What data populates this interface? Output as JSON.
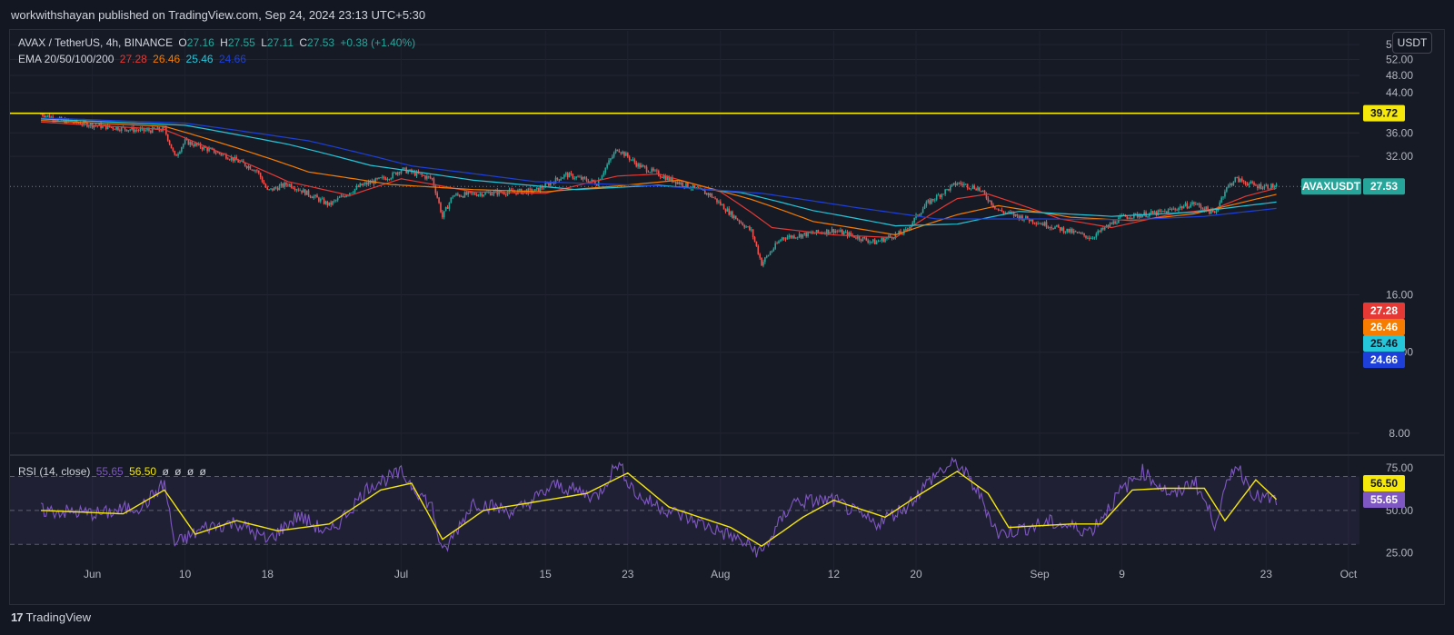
{
  "header": {
    "published_text": "workwithshayan published on TradingView.com, Sep 24, 2024 23:13 UTC+5:30"
  },
  "legend": {
    "symbol": "AVAX / TetherUS, 4h, BINANCE",
    "o_label": "O",
    "o_value": "27.16",
    "h_label": "H",
    "h_value": "27.55",
    "l_label": "L",
    "l_value": "27.11",
    "c_label": "C",
    "c_value": "27.53",
    "change": "+0.38 (+1.40%)",
    "ema_label": "EMA 20/50/100/200",
    "ema20": "27.28",
    "ema50": "26.46",
    "ema100": "25.46",
    "ema200": "24.66"
  },
  "rsi_legend": {
    "label": "RSI (14, close)",
    "rsi": "55.65",
    "ma": "56.50",
    "extras": [
      "ø",
      "ø",
      "ø",
      "ø"
    ]
  },
  "unit_button": "USDT",
  "footer": {
    "brand": "TradingView",
    "logo_glyph": "17"
  },
  "colors": {
    "bg": "#161a25",
    "up": "#26a69a",
    "down": "#ef5350",
    "ema20": "#e53935",
    "ema50": "#f57c00",
    "ema100": "#26c6da",
    "ema200": "#1e40d8",
    "resistance": "#f5e80a",
    "rsi": "#7e57c2",
    "rsi_ma": "#f5e80a"
  },
  "chart_data": [
    {
      "type": "candlestick",
      "title": "AVAX / TetherUS, 4h, BINANCE",
      "y_scale": "log",
      "ylim": [
        7.2,
        60
      ],
      "y_ticks": [
        "56.00",
        "52.00",
        "48.00",
        "44.00",
        "36.00",
        "32.00",
        "16.00",
        "12.00",
        "8.00"
      ],
      "x_ticks": [
        "Jun",
        "10",
        "18",
        "Jul",
        "15",
        "23",
        "Aug",
        "12",
        "20",
        "Sep",
        "9",
        "23",
        "Oct"
      ],
      "resistance_level": {
        "value": 39.72,
        "label": "39.72"
      },
      "last_price": {
        "label": "AVAXUSDT",
        "value": "27.53"
      },
      "price_series": {
        "name": "AVAXUSDT",
        "anchors": [
          [
            "2024-05-27",
            39.6
          ],
          [
            "2024-05-29",
            38.3
          ],
          [
            "2024-06-02",
            37.2
          ],
          [
            "2024-06-06",
            36.4
          ],
          [
            "2024-06-08",
            36.6
          ],
          [
            "2024-06-09",
            31.9
          ],
          [
            "2024-06-10",
            34.5
          ],
          [
            "2024-06-14",
            32.1
          ],
          [
            "2024-06-17",
            29.8
          ],
          [
            "2024-06-18",
            26.9
          ],
          [
            "2024-06-20",
            27.9
          ],
          [
            "2024-06-24",
            25.1
          ],
          [
            "2024-06-27",
            27.6
          ],
          [
            "2024-06-30",
            29.0
          ],
          [
            "2024-07-01",
            30.0
          ],
          [
            "2024-07-04",
            28.6
          ],
          [
            "2024-07-05",
            23.6
          ],
          [
            "2024-07-06",
            26.3
          ],
          [
            "2024-07-10",
            26.7
          ],
          [
            "2024-07-14",
            26.9
          ],
          [
            "2024-07-17",
            29.2
          ],
          [
            "2024-07-20",
            28.0
          ],
          [
            "2024-07-22",
            33.3
          ],
          [
            "2024-07-24",
            30.6
          ],
          [
            "2024-07-27",
            28.6
          ],
          [
            "2024-07-31",
            26.4
          ],
          [
            "2024-08-02",
            24.0
          ],
          [
            "2024-08-04",
            22.0
          ],
          [
            "2024-08-05",
            18.7
          ],
          [
            "2024-08-07",
            21.3
          ],
          [
            "2024-08-12",
            22.1
          ],
          [
            "2024-08-16",
            20.8
          ],
          [
            "2024-08-19",
            22.0
          ],
          [
            "2024-08-21",
            25.2
          ],
          [
            "2024-08-24",
            28.0
          ],
          [
            "2024-08-26",
            27.3
          ],
          [
            "2024-08-28",
            24.4
          ],
          [
            "2024-09-02",
            22.6
          ],
          [
            "2024-09-06",
            21.3
          ],
          [
            "2024-09-09",
            23.6
          ],
          [
            "2024-09-13",
            24.2
          ],
          [
            "2024-09-16",
            25.3
          ],
          [
            "2024-09-18",
            24.0
          ],
          [
            "2024-09-19",
            27.0
          ],
          [
            "2024-09-20",
            28.6
          ],
          [
            "2024-09-22",
            27.6
          ],
          [
            "2024-09-24",
            27.53
          ]
        ]
      },
      "series": [
        {
          "name": "EMA 20",
          "anchors": [
            [
              "2024-05-27",
              38.0
            ],
            [
              "2024-06-08",
              36.6
            ],
            [
              "2024-06-12",
              33.6
            ],
            [
              "2024-06-20",
              28.2
            ],
            [
              "2024-06-26",
              26.3
            ],
            [
              "2024-07-01",
              28.6
            ],
            [
              "2024-07-08",
              26.8
            ],
            [
              "2024-07-15",
              26.6
            ],
            [
              "2024-07-22",
              29.0
            ],
            [
              "2024-07-26",
              29.3
            ],
            [
              "2024-08-01",
              26.8
            ],
            [
              "2024-08-06",
              22.4
            ],
            [
              "2024-08-12",
              21.6
            ],
            [
              "2024-08-18",
              21.3
            ],
            [
              "2024-08-24",
              25.9
            ],
            [
              "2024-08-27",
              26.5
            ],
            [
              "2024-09-03",
              23.4
            ],
            [
              "2024-09-08",
              22.4
            ],
            [
              "2024-09-14",
              24.0
            ],
            [
              "2024-09-18",
              24.6
            ],
            [
              "2024-09-21",
              26.2
            ],
            [
              "2024-09-24",
              27.28
            ]
          ]
        },
        {
          "name": "EMA 50",
          "anchors": [
            [
              "2024-05-27",
              38.3
            ],
            [
              "2024-06-08",
              37.2
            ],
            [
              "2024-06-15",
              33.4
            ],
            [
              "2024-06-22",
              29.6
            ],
            [
              "2024-06-30",
              27.8
            ],
            [
              "2024-07-08",
              27.1
            ],
            [
              "2024-07-15",
              26.8
            ],
            [
              "2024-07-22",
              27.6
            ],
            [
              "2024-07-28",
              28.4
            ],
            [
              "2024-08-04",
              25.8
            ],
            [
              "2024-08-10",
              23.1
            ],
            [
              "2024-08-18",
              21.6
            ],
            [
              "2024-08-24",
              23.9
            ],
            [
              "2024-08-28",
              25.0
            ],
            [
              "2024-09-04",
              23.6
            ],
            [
              "2024-09-10",
              23.2
            ],
            [
              "2024-09-16",
              24.0
            ],
            [
              "2024-09-20",
              25.2
            ],
            [
              "2024-09-24",
              26.46
            ]
          ]
        },
        {
          "name": "EMA 100",
          "anchors": [
            [
              "2024-05-27",
              38.6
            ],
            [
              "2024-06-10",
              37.4
            ],
            [
              "2024-06-20",
              34.0
            ],
            [
              "2024-06-28",
              30.6
            ],
            [
              "2024-07-08",
              28.4
            ],
            [
              "2024-07-18",
              27.1
            ],
            [
              "2024-07-26",
              27.7
            ],
            [
              "2024-08-03",
              26.7
            ],
            [
              "2024-08-10",
              24.4
            ],
            [
              "2024-08-18",
              22.6
            ],
            [
              "2024-08-24",
              22.8
            ],
            [
              "2024-08-30",
              24.3
            ],
            [
              "2024-09-08",
              23.7
            ],
            [
              "2024-09-16",
              24.2
            ],
            [
              "2024-09-24",
              25.46
            ]
          ]
        },
        {
          "name": "EMA 200",
          "anchors": [
            [
              "2024-05-27",
              38.8
            ],
            [
              "2024-06-10",
              37.8
            ],
            [
              "2024-06-22",
              34.6
            ],
            [
              "2024-07-02",
              30.5
            ],
            [
              "2024-07-14",
              28.2
            ],
            [
              "2024-07-26",
              27.6
            ],
            [
              "2024-08-05",
              26.6
            ],
            [
              "2024-08-14",
              24.8
            ],
            [
              "2024-08-22",
              23.4
            ],
            [
              "2024-09-01",
              23.4
            ],
            [
              "2024-09-10",
              23.3
            ],
            [
              "2024-09-17",
              23.7
            ],
            [
              "2024-09-24",
              24.66
            ]
          ]
        }
      ]
    },
    {
      "type": "line",
      "title": "RSI (14, close)",
      "ylim": [
        20,
        82
      ],
      "y_ticks": [
        "75.00",
        "50.00",
        "25.00"
      ],
      "bands": [
        70,
        30
      ],
      "series": [
        {
          "name": "RSI",
          "last": 55.65,
          "anchors": [
            [
              "2024-05-27",
              50
            ],
            [
              "2024-06-02",
              48
            ],
            [
              "2024-06-06",
              53
            ],
            [
              "2024-06-08",
              66
            ],
            [
              "2024-06-09",
              30
            ],
            [
              "2024-06-12",
              40
            ],
            [
              "2024-06-15",
              43
            ],
            [
              "2024-06-18",
              32
            ],
            [
              "2024-06-21",
              47
            ],
            [
              "2024-06-24",
              36
            ],
            [
              "2024-06-28",
              65
            ],
            [
              "2024-07-01",
              72
            ],
            [
              "2024-07-04",
              52
            ],
            [
              "2024-07-05",
              24
            ],
            [
              "2024-07-08",
              55
            ],
            [
              "2024-07-12",
              49
            ],
            [
              "2024-07-16",
              65
            ],
            [
              "2024-07-20",
              58
            ],
            [
              "2024-07-22",
              78
            ],
            [
              "2024-07-24",
              58
            ],
            [
              "2024-07-27",
              50
            ],
            [
              "2024-08-02",
              35
            ],
            [
              "2024-08-05",
              25
            ],
            [
              "2024-08-08",
              55
            ],
            [
              "2024-08-12",
              56
            ],
            [
              "2024-08-16",
              42
            ],
            [
              "2024-08-19",
              52
            ],
            [
              "2024-08-22",
              72
            ],
            [
              "2024-08-24",
              78
            ],
            [
              "2024-08-26",
              61
            ],
            [
              "2024-08-28",
              36
            ],
            [
              "2024-09-02",
              43
            ],
            [
              "2024-09-06",
              38
            ],
            [
              "2024-09-09",
              62
            ],
            [
              "2024-09-11",
              73
            ],
            [
              "2024-09-14",
              58
            ],
            [
              "2024-09-16",
              68
            ],
            [
              "2024-09-18",
              43
            ],
            [
              "2024-09-20",
              78
            ],
            [
              "2024-09-22",
              58
            ],
            [
              "2024-09-24",
              55.65
            ]
          ]
        },
        {
          "name": "RSI MA",
          "last": 56.5,
          "anchors": [
            [
              "2024-05-27",
              50
            ],
            [
              "2024-06-04",
              48
            ],
            [
              "2024-06-08",
              62
            ],
            [
              "2024-06-11",
              36
            ],
            [
              "2024-06-15",
              44
            ],
            [
              "2024-06-19",
              38
            ],
            [
              "2024-06-24",
              42
            ],
            [
              "2024-06-29",
              62
            ],
            [
              "2024-07-02",
              66
            ],
            [
              "2024-07-05",
              33
            ],
            [
              "2024-07-09",
              50
            ],
            [
              "2024-07-15",
              56
            ],
            [
              "2024-07-19",
              60
            ],
            [
              "2024-07-23",
              72
            ],
            [
              "2024-07-27",
              52
            ],
            [
              "2024-08-02",
              40
            ],
            [
              "2024-08-05",
              29
            ],
            [
              "2024-08-09",
              46
            ],
            [
              "2024-08-12",
              56
            ],
            [
              "2024-08-17",
              46
            ],
            [
              "2024-08-20",
              58
            ],
            [
              "2024-08-24",
              73
            ],
            [
              "2024-08-27",
              60
            ],
            [
              "2024-08-29",
              40
            ],
            [
              "2024-09-04",
              42
            ],
            [
              "2024-09-07",
              42
            ],
            [
              "2024-09-10",
              62
            ],
            [
              "2024-09-13",
              63
            ],
            [
              "2024-09-17",
              63
            ],
            [
              "2024-09-19",
              44
            ],
            [
              "2024-09-22",
              68
            ],
            [
              "2024-09-24",
              56.5
            ]
          ]
        }
      ]
    }
  ]
}
